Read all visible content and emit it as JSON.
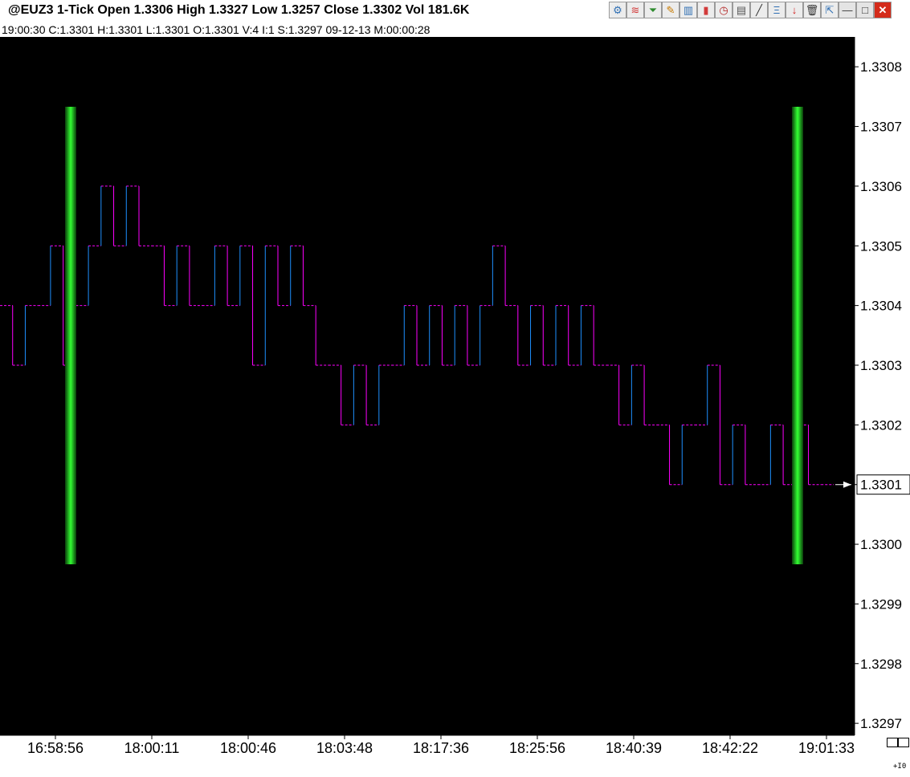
{
  "window": {
    "title": "@EUZ3 1-Tick Open 1.3306 High 1.3327 Low 1.3257 Close 1.3302 Vol 181.6K",
    "status_line": "19:00:30  C:1.3301  H:1.3301  L:1.3301  O:1.3301  V:4  I:1  S:1.3297  09-12-13  M:00:00:28",
    "corner_label": "+I0"
  },
  "toolbar": {
    "icons": [
      "format-chart-icon",
      "indicators-icon",
      "filter-icon",
      "drawing-pencil-icon",
      "bar-chart-icon",
      "candlestick-icon",
      "clock-icon",
      "notes-icon",
      "trendline-icon",
      "fibonacci-icon",
      "arrow-down-icon",
      "delete-icon",
      "cursor-icon",
      "minimize-icon",
      "maximize-icon",
      "close-icon"
    ],
    "glyphs": [
      "⚙",
      "≋",
      "⏷",
      "✎",
      "▥",
      "▮",
      "◷",
      "▤",
      "╱",
      "Ξ",
      "↓",
      "🗑",
      "⇱",
      "—",
      "□",
      "✕"
    ],
    "colors": [
      "#2f6fb3",
      "#d23a3a",
      "#2e8b2e",
      "#c77a00",
      "#2f6fb3",
      "#d23a3a",
      "#b22222",
      "#555555",
      "#333333",
      "#2f6fb3",
      "#d21f1f",
      "#333333",
      "#2f6fb3",
      "#333333",
      "#333333",
      "#ffffff"
    ]
  },
  "chart_data": {
    "type": "line",
    "line_style": "step, dashed",
    "ylim": [
      1.32968,
      1.33085
    ],
    "y_ticks": [
      "1.3308",
      "1.3307",
      "1.3306",
      "1.3305",
      "1.3304",
      "1.3303",
      "1.3302",
      "1.3301",
      "1.3300",
      "1.3299",
      "1.3298",
      "1.3297"
    ],
    "x_tick_labels": [
      "16:58:56",
      "18:00:11",
      "18:00:46",
      "18:03:48",
      "18:17:36",
      "18:25:56",
      "18:40:39",
      "18:42:22",
      "19:01:33"
    ],
    "series": [
      {
        "values": [
          1.3304,
          1.3303,
          1.3304,
          1.3304,
          1.3305,
          1.3303,
          1.3304,
          1.3305,
          1.3306,
          1.3305,
          1.3306,
          1.3305,
          1.3305,
          1.3304,
          1.3305,
          1.3304,
          1.3304,
          1.3305,
          1.3304,
          1.3305,
          1.3303,
          1.3305,
          1.3304,
          1.3305,
          1.3304,
          1.3303,
          1.3303,
          1.3302,
          1.3303,
          1.3302,
          1.3303,
          1.3303,
          1.3304,
          1.3303,
          1.3304,
          1.3303,
          1.3304,
          1.3303,
          1.3304,
          1.3305,
          1.3304,
          1.3303,
          1.3304,
          1.3303,
          1.3304,
          1.3303,
          1.3304,
          1.3303,
          1.3303,
          1.3302,
          1.3303,
          1.3302,
          1.3302,
          1.3301,
          1.3302,
          1.3302,
          1.3303,
          1.3301,
          1.3302,
          1.3301,
          1.3301,
          1.3302,
          1.3301,
          1.3302,
          1.3301,
          1.3301
        ]
      }
    ],
    "last_price": "1.3301",
    "colors": {
      "background": "#000000",
      "up": "#1e90ff",
      "down": "#ff00ff",
      "marker": "#00e000",
      "axis_text": "#ffffff",
      "last_box": "#ffffff"
    },
    "grid": false,
    "vertical_markers": 2
  }
}
